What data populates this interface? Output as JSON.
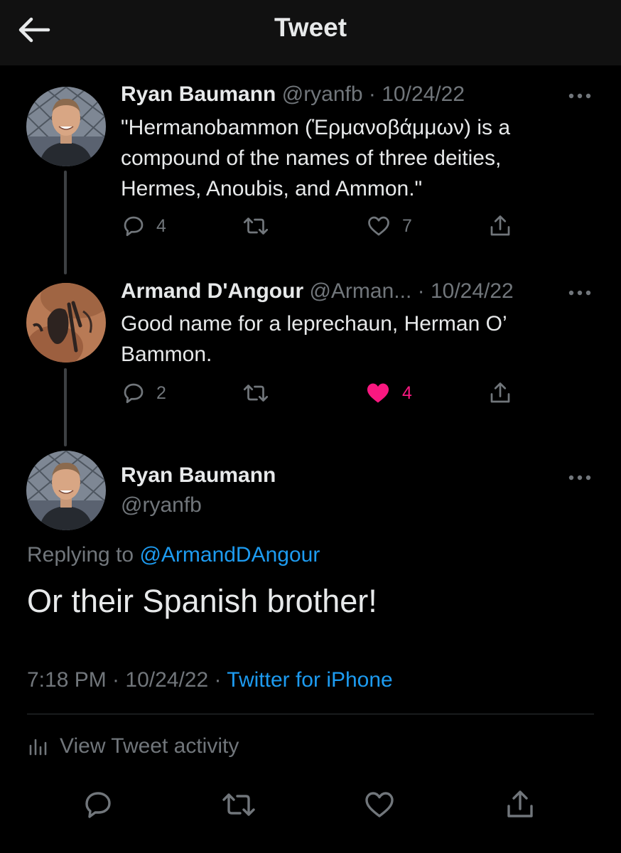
{
  "header": {
    "title": "Tweet"
  },
  "tweets": [
    {
      "name": "Ryan Baumann",
      "handle": "@ryanfb",
      "date": "· 10/24/22",
      "text": "\"Hermanobammon (Ἑρμανοβάμμων) is a compound of the names of three deities, Hermes, Anoubis, and Ammon.\"",
      "replies": "4",
      "likes": "7"
    },
    {
      "name": "Armand D'Angour",
      "handle": "@Arman...",
      "date": "· 10/24/22",
      "text": "Good name for a leprechaun, Herman O’ Bammon.",
      "replies": "2",
      "likes": "4",
      "liked": true
    }
  ],
  "main_tweet": {
    "name": "Ryan Baumann",
    "handle": "@ryanfb",
    "replying_prefix": "Replying to ",
    "replying_to": "@ArmandDAngour",
    "text": "Or their Spanish brother!",
    "time": "7:18 PM · 10/24/22 ·",
    "source": "Twitter for iPhone",
    "activity_label": "View Tweet activity"
  },
  "colors": {
    "link": "#1d9bf0",
    "like": "#f91880",
    "muted": "#71767b",
    "text": "#e7e9ea"
  }
}
